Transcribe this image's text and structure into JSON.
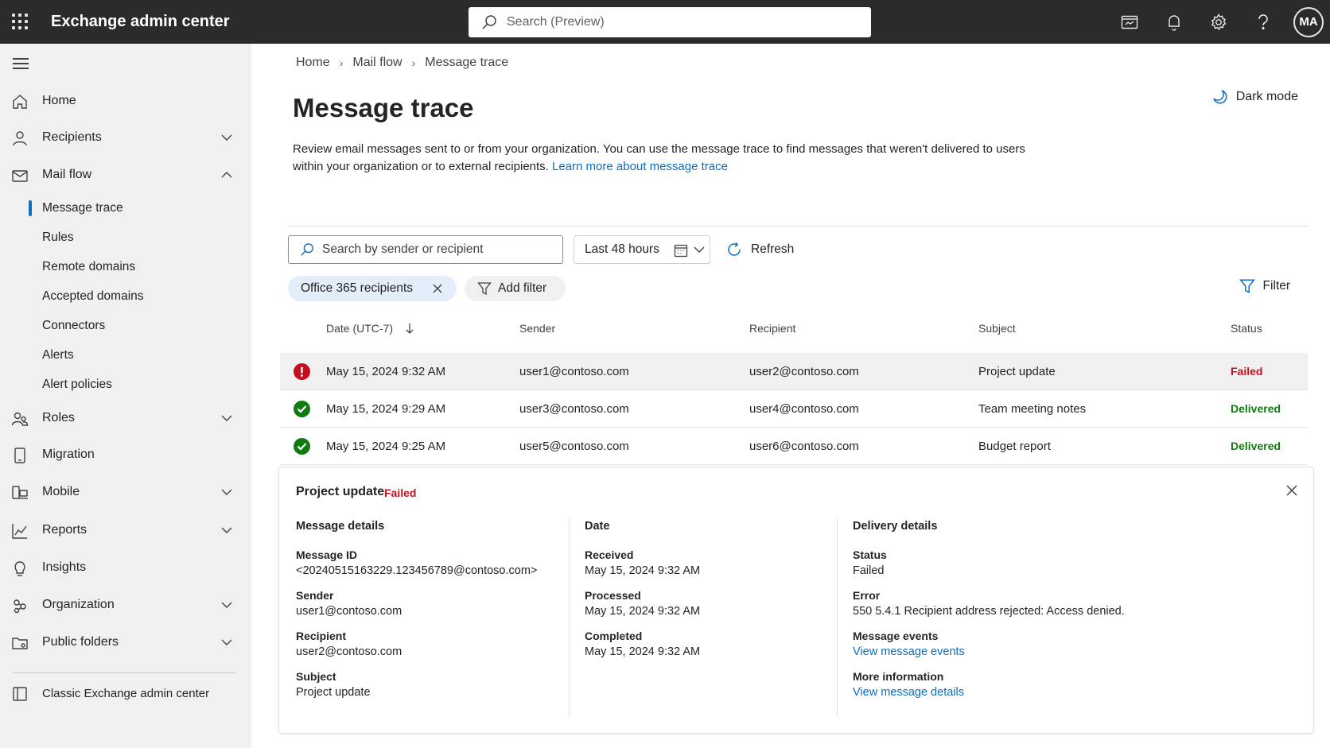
{
  "topbar": {
    "app_title": "Exchange admin center",
    "search_placeholder": "Search (Preview)",
    "avatar_initials": "MA"
  },
  "sidebar": {
    "items": [
      {
        "label": "Home",
        "icon": "home-icon",
        "expandable": false
      },
      {
        "label": "Recipients",
        "icon": "person-icon",
        "expandable": true,
        "expanded": false
      },
      {
        "label": "Mail flow",
        "icon": "mail-icon",
        "expandable": true,
        "expanded": true
      },
      {
        "label": "Roles",
        "icon": "people-icon",
        "expandable": true,
        "expanded": false
      },
      {
        "label": "Migration",
        "icon": "mobile-icon",
        "expandable": false
      },
      {
        "label": "Mobile",
        "icon": "phone-laptop-icon",
        "expandable": true,
        "expanded": false
      },
      {
        "label": "Reports",
        "icon": "chart-icon",
        "expandable": true,
        "expanded": false
      },
      {
        "label": "Insights",
        "icon": "lightbulb-icon",
        "expandable": false
      },
      {
        "label": "Organization",
        "icon": "organization-icon",
        "expandable": true,
        "expanded": false
      },
      {
        "label": "Public folders",
        "icon": "folder-icon",
        "expandable": true,
        "expanded": false
      }
    ],
    "mailflow_subitems": [
      "Message trace",
      "Rules",
      "Remote domains",
      "Accepted domains",
      "Connectors",
      "Alerts",
      "Alert policies"
    ],
    "active_subitem": "Message trace",
    "classic_link": "Classic Exchange admin center"
  },
  "breadcrumb": [
    "Home",
    "Mail flow",
    "Message trace"
  ],
  "page": {
    "title": "Message trace",
    "dark_mode_label": "Dark mode",
    "description": "Review email messages sent to or from your organization. You can use the message trace to find messages that weren't delivered to users within your organization or to external recipients.",
    "learn_more": "Learn more about message trace"
  },
  "toolbar": {
    "search_placeholder": "Search by sender or recipient",
    "date_range": "Last 48 hours",
    "refresh_label": "Refresh",
    "active_filter": "Office 365 recipients",
    "add_filter_label": "Add filter",
    "filter_label": "Filter"
  },
  "table": {
    "columns": [
      "Date (UTC-7)",
      "Sender",
      "Recipient",
      "Subject",
      "Status"
    ],
    "sort_column": "Date (UTC-7)",
    "sort_direction": "descending",
    "rows": [
      {
        "date": "May 15, 2024 9:32 AM",
        "sender": "user1@contoso.com",
        "recipient": "user2@contoso.com",
        "subject": "Project update",
        "status": "Failed",
        "status_icon": "error-icon"
      },
      {
        "date": "May 15, 2024 9:29 AM",
        "sender": "user3@contoso.com",
        "recipient": "user4@contoso.com",
        "subject": "Team meeting notes",
        "status": "Delivered",
        "status_icon": "check-circle-icon"
      },
      {
        "date": "May 15, 2024 9:25 AM",
        "sender": "user5@contoso.com",
        "recipient": "user6@contoso.com",
        "subject": "Budget report",
        "status": "Delivered",
        "status_icon": "check-circle-icon"
      }
    ]
  },
  "details": {
    "title": "Project update",
    "status": "Failed",
    "message_details": {
      "heading": "Message details",
      "message_id_label": "Message ID",
      "message_id": "<20240515163229.123456789@contoso.com>",
      "sender_label": "Sender",
      "sender": "user1@contoso.com",
      "recipient_label": "Recipient",
      "recipient": "user2@contoso.com",
      "subject_label": "Subject",
      "subject": "Project update"
    },
    "date": {
      "heading": "Date",
      "received_label": "Received",
      "received": "May 15, 2024 9:32 AM",
      "processed_label": "Processed",
      "processed": "May 15, 2024 9:32 AM",
      "completed_label": "Completed",
      "completed": "May 15, 2024 9:32 AM"
    },
    "delivery": {
      "heading": "Delivery details",
      "status_label": "Status",
      "status": "Failed",
      "error_label": "Error",
      "error": "550 5.4.1 Recipient address rejected: Access denied.",
      "events_label": "Message events",
      "events_link": "View message events",
      "more_label": "More information",
      "more_link": "View message details"
    }
  },
  "colors": {
    "topbar": "#2b2b2b",
    "sidebar": "#f0f0f0",
    "accent": "#0f6cbd",
    "failed": "#c50f1f",
    "delivered": "#107c10",
    "chip_active": "#e3eefa"
  }
}
